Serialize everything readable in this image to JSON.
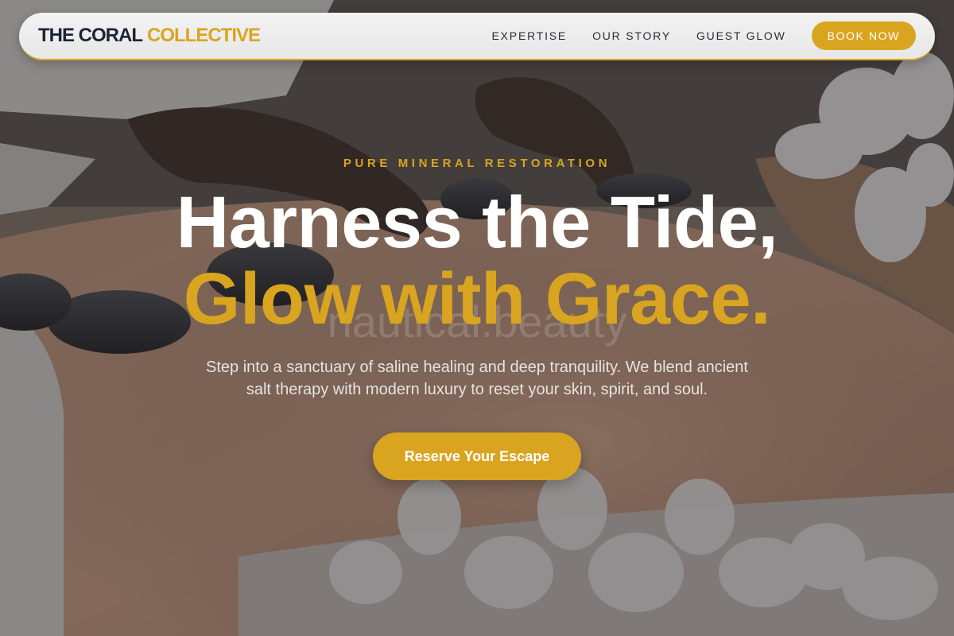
{
  "brand": {
    "name_primary": "THE CORAL",
    "name_accent": "COLLECTIVE"
  },
  "nav": {
    "links": [
      "EXPERTISE",
      "OUR STORY",
      "GUEST GLOW"
    ],
    "cta_label": "BOOK NOW"
  },
  "hero": {
    "eyebrow": "PURE MINERAL RESTORATION",
    "headline_line1": "Harness the Tide,",
    "headline_line2": "Glow with Grace.",
    "watermark": "nautical.beauty",
    "subtitle": "Step into a sanctuary of saline healing and deep tranquility. We blend ancient salt therapy with modern luxury to reset your skin, spirit, and soul.",
    "cta_label": "Reserve Your Escape",
    "background_icon": "hot-stone-massage-photo"
  },
  "colors": {
    "accent": "#d9a520",
    "brand_dark": "#1c2436",
    "nav_bg": "#efefef"
  }
}
